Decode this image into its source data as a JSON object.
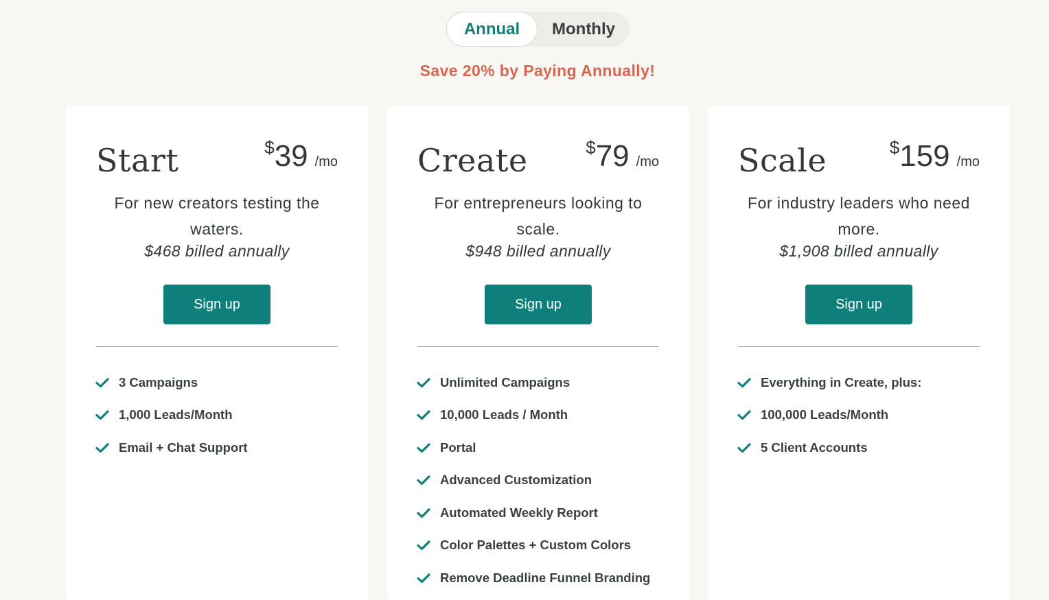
{
  "billing_toggle": {
    "options": [
      {
        "label": "Annual",
        "selected": true
      },
      {
        "label": "Monthly",
        "selected": false
      }
    ]
  },
  "save_banner": "Save 20% by Paying Annually!",
  "colors": {
    "accent": "#0f7f7c",
    "promo": "#d9654f",
    "background": "#f8f7f4",
    "text": "#33383d"
  },
  "plans": [
    {
      "name": "Start",
      "currency": "$",
      "price": "39",
      "period": "/mo",
      "description": "For new creators testing the waters.",
      "billed": "$468 billed annually",
      "cta": "Sign up",
      "features": [
        {
          "icon": "check-icon",
          "label": "3 Campaigns"
        },
        {
          "icon": "check-icon",
          "label": "1,000 Leads/Month"
        },
        {
          "icon": "check-icon",
          "label": "Email + Chat Support"
        }
      ]
    },
    {
      "name": "Create",
      "currency": "$",
      "price": "79",
      "period": "/mo",
      "description": "For entrepreneurs looking to scale.",
      "billed": "$948 billed annually",
      "cta": "Sign up",
      "features": [
        {
          "icon": "check-icon",
          "label": "Unlimited Campaigns"
        },
        {
          "icon": "check-icon",
          "label": "10,000 Leads / Month"
        },
        {
          "icon": "check-icon",
          "label": "Portal"
        },
        {
          "icon": "check-icon",
          "label": "Advanced Customization"
        },
        {
          "icon": "check-icon",
          "label": "Automated Weekly Report"
        },
        {
          "icon": "check-icon",
          "label": "Color Palettes + Custom Colors"
        },
        {
          "icon": "check-icon",
          "label": "Remove Deadline Funnel Branding"
        }
      ]
    },
    {
      "name": "Scale",
      "currency": "$",
      "price": "159",
      "period": "/mo",
      "description": "For industry leaders who need more.",
      "billed": "$1,908 billed annually",
      "cta": "Sign up",
      "features": [
        {
          "icon": "check-icon",
          "label": "Everything in Create, plus:"
        },
        {
          "icon": "check-icon",
          "label": "100,000 Leads/Month"
        },
        {
          "icon": "check-icon",
          "label": "5 Client Accounts"
        }
      ]
    }
  ]
}
